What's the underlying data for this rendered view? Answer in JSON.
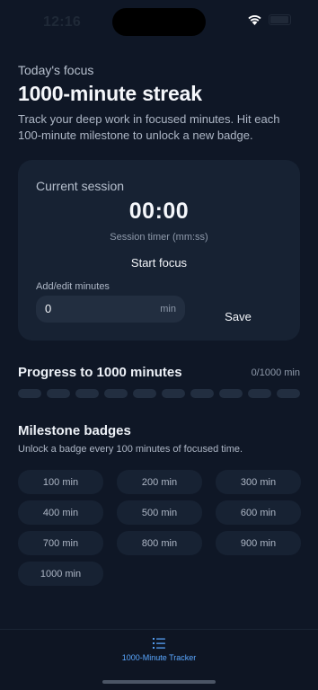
{
  "status": {
    "time": "12:16"
  },
  "header": {
    "eyebrow": "Today's focus",
    "title": "1000-minute streak",
    "subtitle": "Track your deep work in focused minutes. Hit each 100-minute milestone to unlock a new badge."
  },
  "session": {
    "label": "Current session",
    "timer": "00:00",
    "timer_caption": "Session timer (mm:ss)",
    "start_label": "Start focus",
    "field_label": "Add/edit minutes",
    "field_value": "0",
    "field_unit": "min",
    "save_label": "Save"
  },
  "progress": {
    "title": "Progress to 1000 minutes",
    "count": "0/1000 min",
    "fraction": 0
  },
  "badges": {
    "title": "Milestone badges",
    "subtitle": "Unlock a badge every 100 minutes of focused time.",
    "items": [
      "100 min",
      "200 min",
      "300 min",
      "400 min",
      "500 min",
      "600 min",
      "700 min",
      "800 min",
      "900 min",
      "1000 min"
    ]
  },
  "tabbar": {
    "label": "1000-Minute Tracker",
    "icon": "list-icon",
    "accent": "#5aa7ff"
  },
  "colors": {
    "background": "#0f1726",
    "card": "#172233",
    "accent": "#5aa7ff"
  }
}
